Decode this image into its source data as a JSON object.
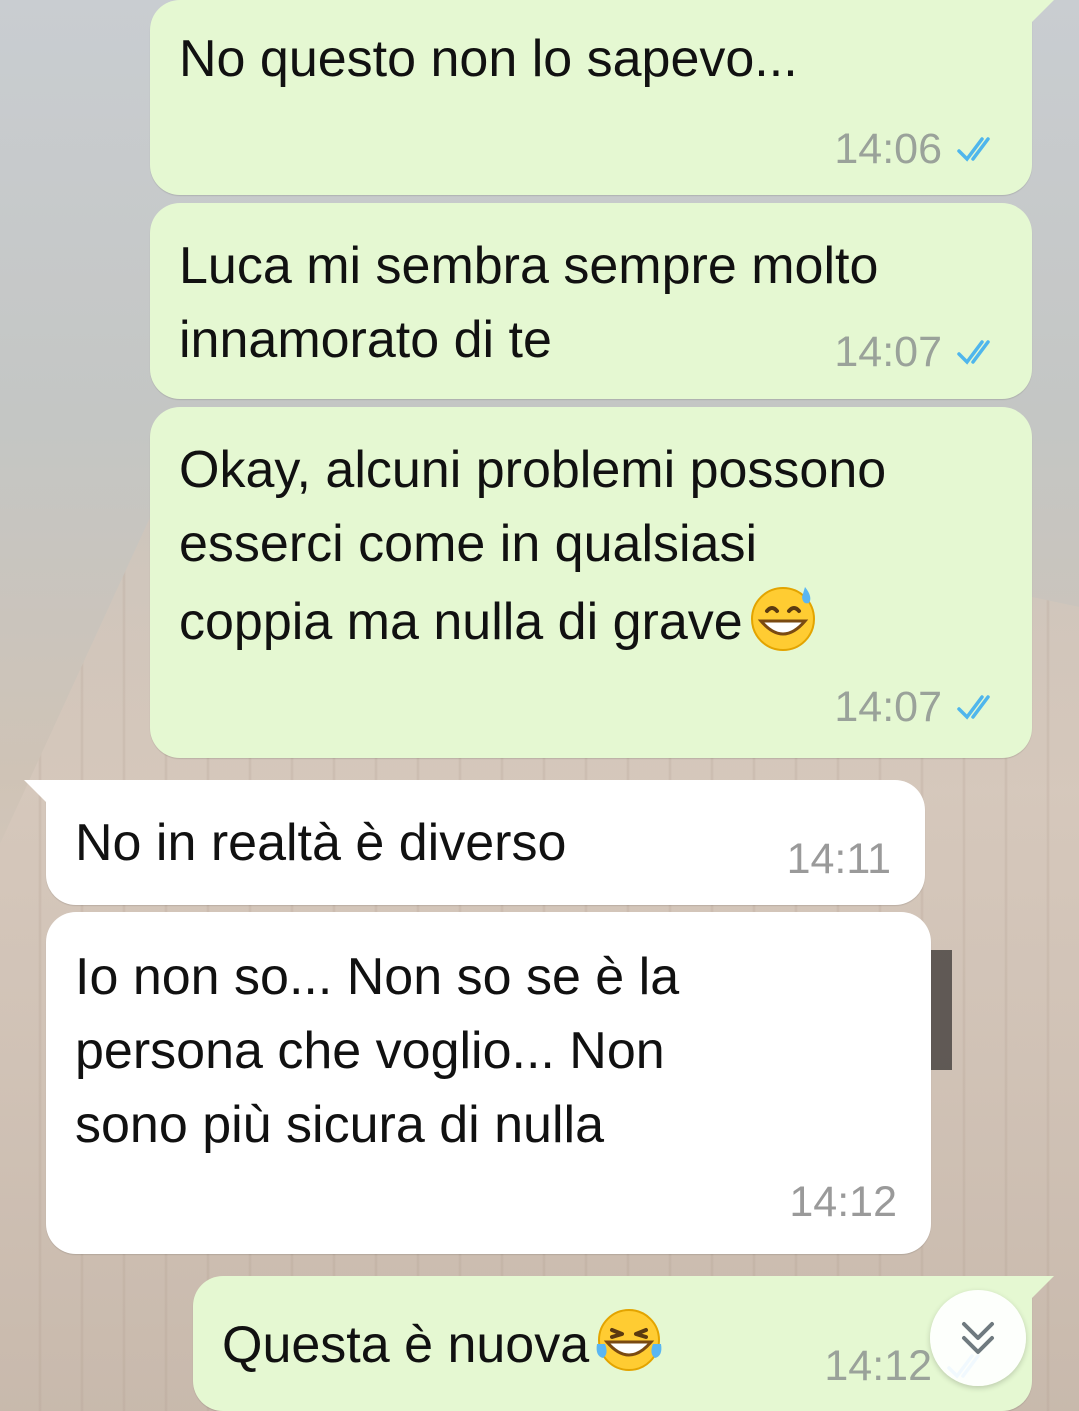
{
  "messages": [
    {
      "direction": "outgoing",
      "text": "No questo non lo sapevo...",
      "time": "14:06",
      "status": "read"
    },
    {
      "direction": "outgoing",
      "text": "Luca mi sembra sempre molto\ninnamorato di te",
      "time": "14:07",
      "status": "read"
    },
    {
      "direction": "outgoing",
      "text": "Okay, alcuni problemi possono\nesserci come in qualsiasi\ncoppia ma nulla di grave",
      "emoji": "grinning-face-with-sweat",
      "time": "14:07",
      "status": "read"
    },
    {
      "direction": "incoming",
      "text": "No in realtà è diverso",
      "time": "14:11"
    },
    {
      "direction": "incoming",
      "text": "Io non so... Non so se è la\npersona che voglio... Non\nsono più sicura di nulla",
      "time": "14:12"
    },
    {
      "direction": "outgoing",
      "text": "Questa è nuova",
      "emoji": "face-with-tears-of-joy",
      "time": "14:12",
      "status": "read"
    }
  ],
  "colors": {
    "outgoing_bubble": "#e5f8d2",
    "incoming_bubble": "#ffffff",
    "read_ticks": "#4fb6ec",
    "timestamp": "#9aa29a"
  },
  "scroll_button": {
    "icon": "double-chevron-down-icon"
  }
}
